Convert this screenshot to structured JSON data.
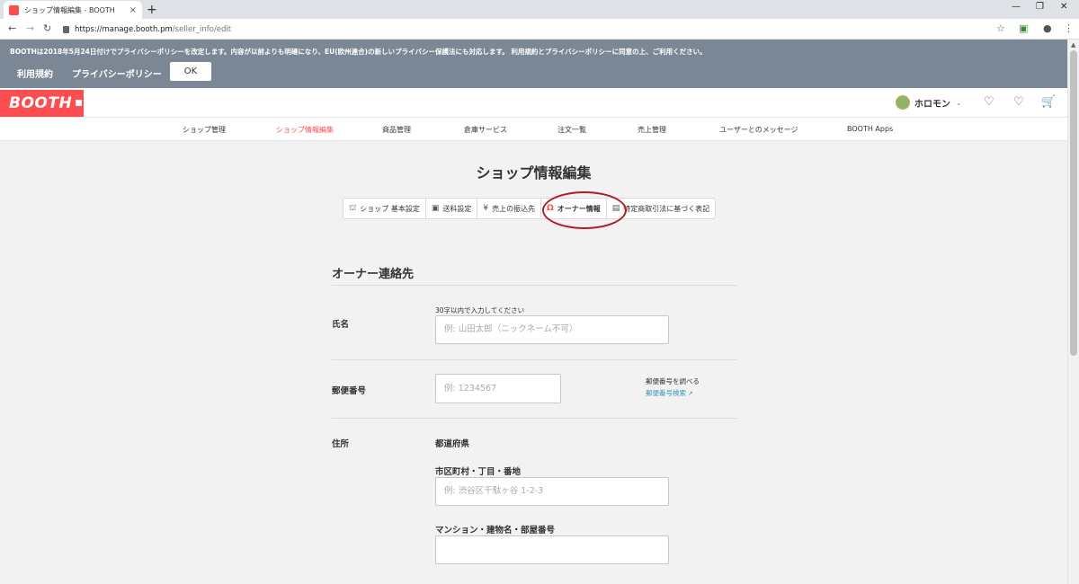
{
  "browser": {
    "tab_title": "ショップ情報編集 - BOOTH",
    "tab_close": "×",
    "new_tab": "+",
    "url_host": "https://manage.booth.pm",
    "url_path": "/seller_info/edit",
    "icons": {
      "back": "arrow-left-icon",
      "forward": "arrow-right-icon",
      "reload": "reload-icon",
      "lock": "lock-icon",
      "star": "star-icon",
      "profile": "profile-icon",
      "menu": "kebab-menu-icon"
    }
  },
  "banner": {
    "text": "BOOTHは2018年5月24日付けでプライバシーポリシーを改定します。内容が以前よりも明確になり、EU(欧州連合)の新しいプライバシー保護法にも対応します。 利用規約とプライバシーポリシーに同意の上、ご利用ください。",
    "terms_link": "利用規約",
    "privacy_link": "プライバシーポリシー",
    "ok_label": "OK"
  },
  "header": {
    "logo_text": "BOOTH",
    "user_name": "ホロモン",
    "icons": {
      "notifications": "bell-icon",
      "favorites": "heart-icon",
      "cart": "cart-icon"
    }
  },
  "subnav": {
    "items": [
      {
        "label": "ショップ管理"
      },
      {
        "label": "ショップ情報編集"
      },
      {
        "label": "商品管理"
      },
      {
        "label": "倉庫サービス"
      },
      {
        "label": "注文一覧"
      },
      {
        "label": "売上管理"
      },
      {
        "label": "ユーザーとのメッセージ"
      },
      {
        "label": "BOOTH Apps"
      }
    ],
    "active_index": 1
  },
  "main": {
    "page_title": "ショップ情報編集",
    "tabs": [
      {
        "label": "ショップ 基本設定",
        "icon": "shop-icon"
      },
      {
        "label": "送料設定",
        "icon": "truck-icon"
      },
      {
        "label": "売上の振込先",
        "icon": "yen-icon"
      },
      {
        "label": "オーナー情報",
        "icon": "person-icon"
      },
      {
        "label": "特定商取引法に基づく表記",
        "icon": "document-icon"
      }
    ],
    "active_tab": "オーナー情報",
    "section_title": "オーナー連絡先",
    "name": {
      "label": "氏名",
      "hint": "30字以内で入力してください",
      "placeholder": "例: 山田太郎（ニックネーム不可）"
    },
    "postal": {
      "label": "郵便番号",
      "placeholder": "例: 1234567",
      "lookup_title": "郵便番号を調べる",
      "lookup_link": "郵便番号検索"
    },
    "address": {
      "label": "住所",
      "prefecture_label": "都道府県",
      "city_label": "市区町村・丁目・番地",
      "city_placeholder": "例: 渋谷区千駄ヶ谷 1-2-3",
      "building_label": "マンション・建物名・部屋番号",
      "building_placeholder": ""
    }
  },
  "colors": {
    "brand": "#fc4d50",
    "banner": "#7b8794",
    "link": "#3a94b8",
    "annotation": "#b01e24"
  }
}
